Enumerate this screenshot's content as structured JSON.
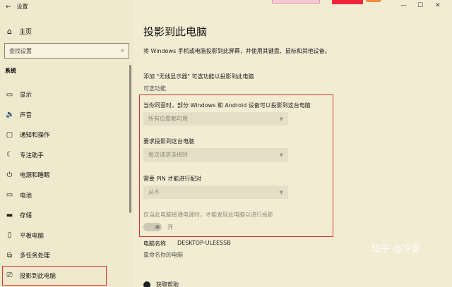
{
  "window": {
    "title": "设置",
    "back_icon": "back-arrow-icon"
  },
  "sidebar": {
    "home": {
      "label": "主页",
      "icon": "home-icon"
    },
    "search": {
      "placeholder": "查找设置"
    },
    "section": "系统",
    "items": [
      {
        "label": "显示",
        "icon": "display-icon",
        "glyph": "▭"
      },
      {
        "label": "声音",
        "icon": "sound-icon",
        "glyph": "🔈"
      },
      {
        "label": "通知和操作",
        "icon": "notification-icon",
        "glyph": "▢"
      },
      {
        "label": "专注助手",
        "icon": "moon-icon",
        "glyph": "☾"
      },
      {
        "label": "电源和睡眠",
        "icon": "power-icon",
        "glyph": "⏻"
      },
      {
        "label": "电池",
        "icon": "battery-icon",
        "glyph": "▭"
      },
      {
        "label": "存储",
        "icon": "storage-icon",
        "glyph": "▬"
      },
      {
        "label": "平板电脑",
        "icon": "tablet-icon",
        "glyph": "▯"
      },
      {
        "label": "多任务处理",
        "icon": "multitask-icon",
        "glyph": "⧉"
      },
      {
        "label": "投影到此电脑",
        "icon": "project-icon",
        "glyph": "⎚",
        "active": true
      }
    ]
  },
  "main": {
    "title": "投影到此电脑",
    "description": "将 Windows 手机或电脑投影到此屏幕，并使用其键盘、鼠标和其他设备。",
    "add_line": "添加 \"无线显示器\" 可选功能以投影到此电脑",
    "optional_features": "可选功能",
    "settings": [
      {
        "label": "当你同意时，部分 Windows 和 Android 设备可以投影到这台电脑",
        "value": "所有位置都可用"
      },
      {
        "label": "要求投影到这台电脑",
        "value": "每次请求连接时"
      },
      {
        "label": "需要 PIN 才能进行配对",
        "value": "从不"
      }
    ],
    "note": "仅当此电脑接通电源时，才能发现此电脑以进行投影",
    "toggle_label": "开",
    "pc_name_label": "电脑名称",
    "pc_name_value": "DESKTOP-ULEESSB",
    "rename": "重命名你的电脑",
    "help": "获取帮助"
  },
  "watermark": "知乎 @冷壹",
  "colors": {
    "highlight": "#d9342b",
    "background": "#f1ecd2"
  }
}
